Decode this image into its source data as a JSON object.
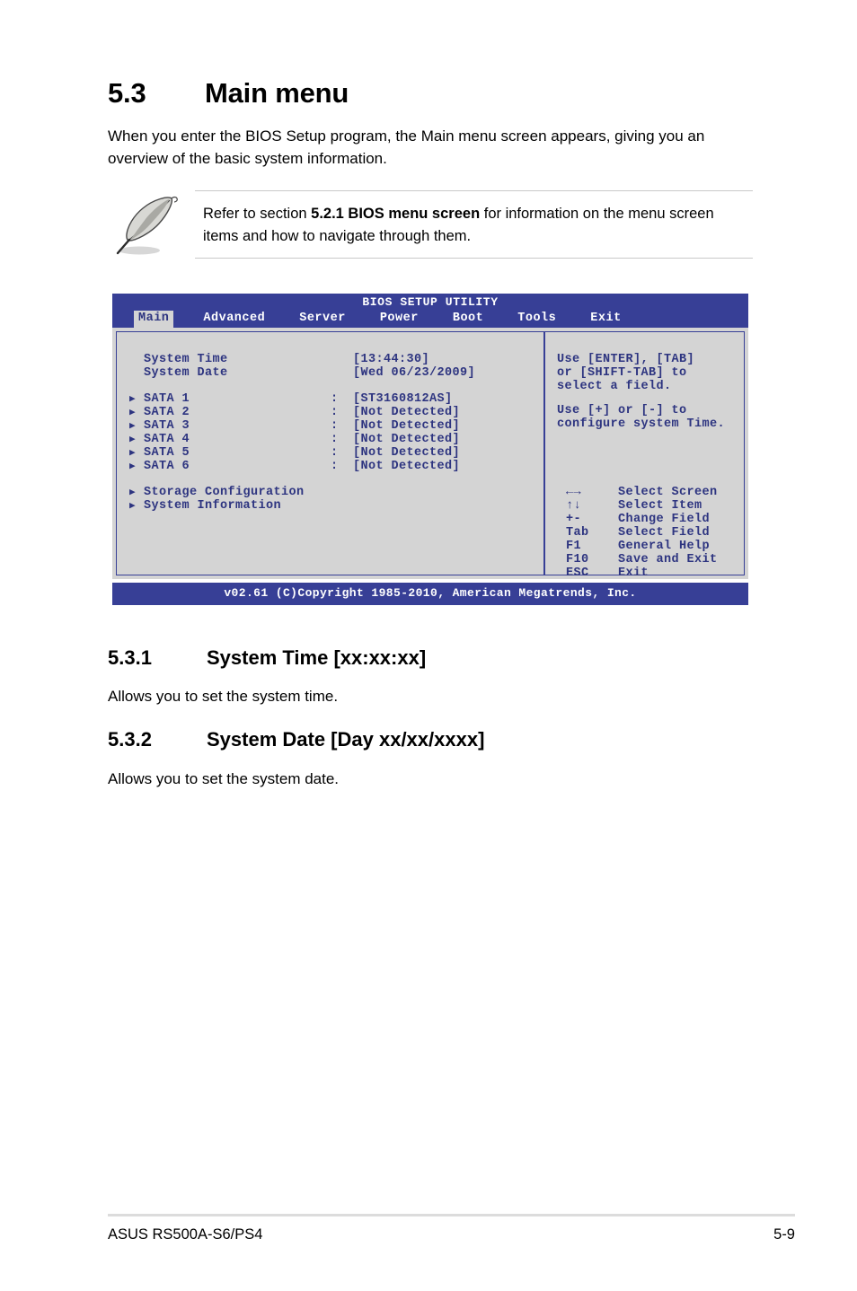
{
  "section": {
    "number": "5.3",
    "title": "Main menu",
    "intro": "When you enter the BIOS Setup program, the Main menu screen appears, giving you an overview of the basic system information."
  },
  "note": {
    "icon": "quill-pen-icon",
    "text_before": "Refer to section ",
    "text_bold": "5.2.1 BIOS menu screen",
    "text_after": " for information on the menu screen items and how to navigate through them."
  },
  "bios": {
    "title": "BIOS SETUP UTILITY",
    "tabs": [
      {
        "label": "Main",
        "active": true
      },
      {
        "label": "Advanced",
        "active": false
      },
      {
        "label": "Server",
        "active": false
      },
      {
        "label": "Power",
        "active": false
      },
      {
        "label": "Boot",
        "active": false
      },
      {
        "label": "Tools",
        "active": false
      },
      {
        "label": "Exit",
        "active": false
      }
    ],
    "fields": [
      {
        "label": "System Time",
        "colon": "",
        "value": "[13:44:30]",
        "arrow": false
      },
      {
        "label": "System Date",
        "colon": "",
        "value": "[Wed 06/23/2009]",
        "arrow": false
      }
    ],
    "sata": [
      {
        "label": "SATA 1",
        "colon": ":",
        "value": "[ST3160812AS]",
        "arrow": true
      },
      {
        "label": "SATA 2",
        "colon": ":",
        "value": "[Not Detected]",
        "arrow": true
      },
      {
        "label": "SATA 3",
        "colon": ":",
        "value": "[Not Detected]",
        "arrow": true
      },
      {
        "label": "SATA 4",
        "colon": ":",
        "value": "[Not Detected]",
        "arrow": true
      },
      {
        "label": "SATA 5",
        "colon": ":",
        "value": "[Not Detected]",
        "arrow": true
      },
      {
        "label": "SATA 6",
        "colon": ":",
        "value": "[Not Detected]",
        "arrow": true
      }
    ],
    "submenus": [
      {
        "label": "Storage Configuration",
        "arrow": true
      },
      {
        "label": "System Information",
        "arrow": true
      }
    ],
    "help": [
      "Use [ENTER], [TAB]",
      "or [SHIFT-TAB] to",
      "select a field.",
      "",
      "Use [+] or [-] to",
      "configure system Time."
    ],
    "keys": [
      {
        "key": "←→",
        "desc": "Select Screen"
      },
      {
        "key": "↑↓",
        "desc": "Select Item"
      },
      {
        "key": "+-",
        "desc": "Change Field"
      },
      {
        "key": "Tab",
        "desc": "Select Field"
      },
      {
        "key": "F1",
        "desc": "General Help"
      },
      {
        "key": "F10",
        "desc": "Save and Exit"
      },
      {
        "key": "ESC",
        "desc": "Exit"
      }
    ],
    "footer": "v02.61 (C)Copyright 1985-2010, American Megatrends, Inc.",
    "colors": {
      "chrome": "#373f96",
      "body_bg": "#d4d4d4",
      "text": "#2d3480",
      "active_tab_bg": "#d4d4d4"
    }
  },
  "subsections": [
    {
      "number": "5.3.1",
      "title": "System Time [xx:xx:xx]",
      "body": "Allows you to set the system time."
    },
    {
      "number": "5.3.2",
      "title": "System Date [Day xx/xx/xxxx]",
      "body": "Allows you to set the system date."
    }
  ],
  "footer": {
    "left": "ASUS RS500A-S6/PS4",
    "right": "5-9"
  }
}
